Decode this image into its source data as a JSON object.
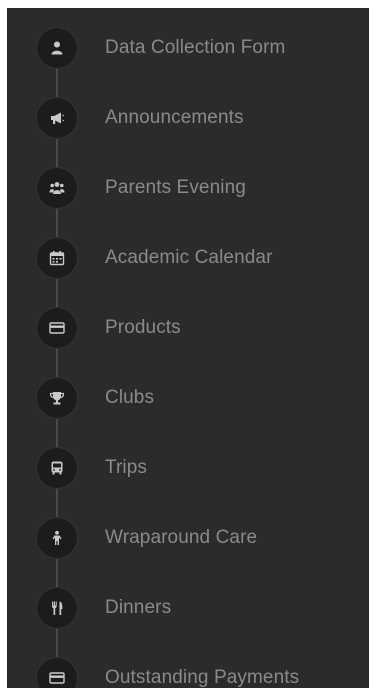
{
  "menu": {
    "items": [
      {
        "label": "Data Collection Form",
        "icon": "user-icon"
      },
      {
        "label": "Announcements",
        "icon": "megaphone-icon"
      },
      {
        "label": "Parents Evening",
        "icon": "users-icon"
      },
      {
        "label": "Academic Calendar",
        "icon": "calendar-icon"
      },
      {
        "label": "Products",
        "icon": "credit-card-icon"
      },
      {
        "label": "Clubs",
        "icon": "trophy-icon"
      },
      {
        "label": "Trips",
        "icon": "bus-icon"
      },
      {
        "label": "Wraparound Care",
        "icon": "child-icon"
      },
      {
        "label": "Dinners",
        "icon": "cutlery-icon"
      },
      {
        "label": "Outstanding Payments",
        "icon": "credit-card-icon"
      }
    ]
  },
  "colors": {
    "background": "#2b2b2b",
    "icon_circle": "#1c1c1c",
    "icon": "#c9c9c9",
    "text": "#8a8a8a"
  }
}
